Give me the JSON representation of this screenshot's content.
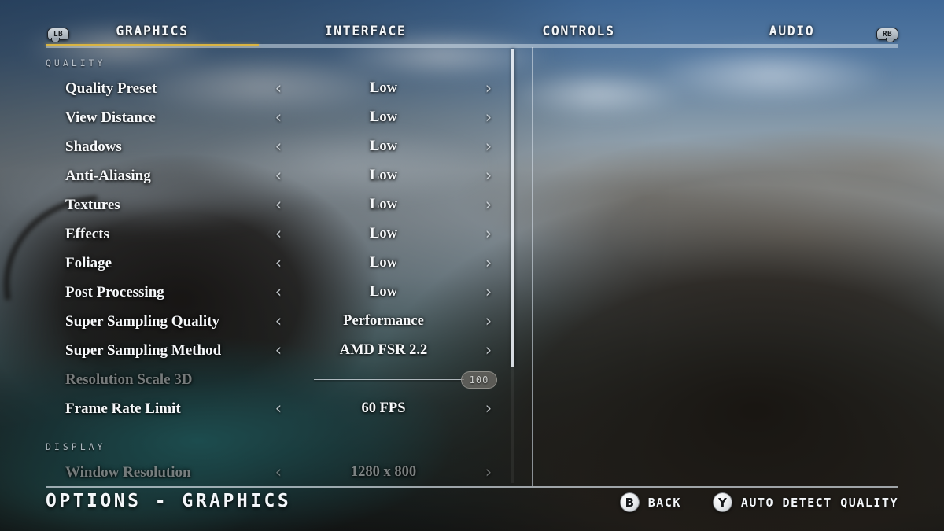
{
  "header": {
    "left_bumper": "LB",
    "right_bumper": "RB",
    "tabs": [
      {
        "label": "GRAPHICS",
        "active": true
      },
      {
        "label": "INTERFACE",
        "active": false
      },
      {
        "label": "CONTROLS",
        "active": false
      },
      {
        "label": "AUDIO",
        "active": false
      }
    ],
    "active_tab_color": "#d9b441"
  },
  "settings": {
    "groups": [
      {
        "title": "QUALITY",
        "rows": [
          {
            "label": "Quality Preset",
            "type": "stepper",
            "value": "Low",
            "disabled": false,
            "left_arrow": "‹",
            "right_arrow": "›"
          },
          {
            "label": "View Distance",
            "type": "stepper",
            "value": "Low",
            "disabled": false,
            "left_arrow": "‹",
            "right_arrow": "›"
          },
          {
            "label": "Shadows",
            "type": "stepper",
            "value": "Low",
            "disabled": false,
            "left_arrow": "‹",
            "right_arrow": "›"
          },
          {
            "label": "Anti-Aliasing",
            "type": "stepper",
            "value": "Low",
            "disabled": false,
            "left_arrow": "‹",
            "right_arrow": "›"
          },
          {
            "label": "Textures",
            "type": "stepper",
            "value": "Low",
            "disabled": false,
            "left_arrow": "‹",
            "right_arrow": "›"
          },
          {
            "label": "Effects",
            "type": "stepper",
            "value": "Low",
            "disabled": false,
            "left_arrow": "‹",
            "right_arrow": "›"
          },
          {
            "label": "Foliage",
            "type": "stepper",
            "value": "Low",
            "disabled": false,
            "left_arrow": "‹",
            "right_arrow": "›"
          },
          {
            "label": "Post Processing",
            "type": "stepper",
            "value": "Low",
            "disabled": false,
            "left_arrow": "‹",
            "right_arrow": "›"
          },
          {
            "label": "Super Sampling Quality",
            "type": "stepper",
            "value": "Performance",
            "disabled": false,
            "left_arrow": "‹",
            "right_arrow": "›"
          },
          {
            "label": "Super Sampling Method",
            "type": "stepper",
            "value": "AMD FSR 2.2",
            "disabled": false,
            "left_arrow": "‹",
            "right_arrow": "›"
          },
          {
            "label": "Resolution Scale 3D",
            "type": "slider",
            "value": "100",
            "disabled": true,
            "slider_percent": 100
          },
          {
            "label": "Frame Rate Limit",
            "type": "stepper",
            "value": "60 FPS",
            "disabled": false,
            "left_arrow": "‹",
            "right_arrow": "›"
          }
        ]
      },
      {
        "title": "DISPLAY",
        "rows": [
          {
            "label": "Window Resolution",
            "type": "stepper",
            "value": "1280 x 800",
            "disabled": true,
            "left_arrow": "‹",
            "right_arrow": "›"
          }
        ]
      }
    ]
  },
  "footer": {
    "title": "OPTIONS - GRAPHICS",
    "prompts": [
      {
        "button": "B",
        "label": "BACK"
      },
      {
        "button": "Y",
        "label": "AUTO DETECT QUALITY"
      }
    ]
  }
}
